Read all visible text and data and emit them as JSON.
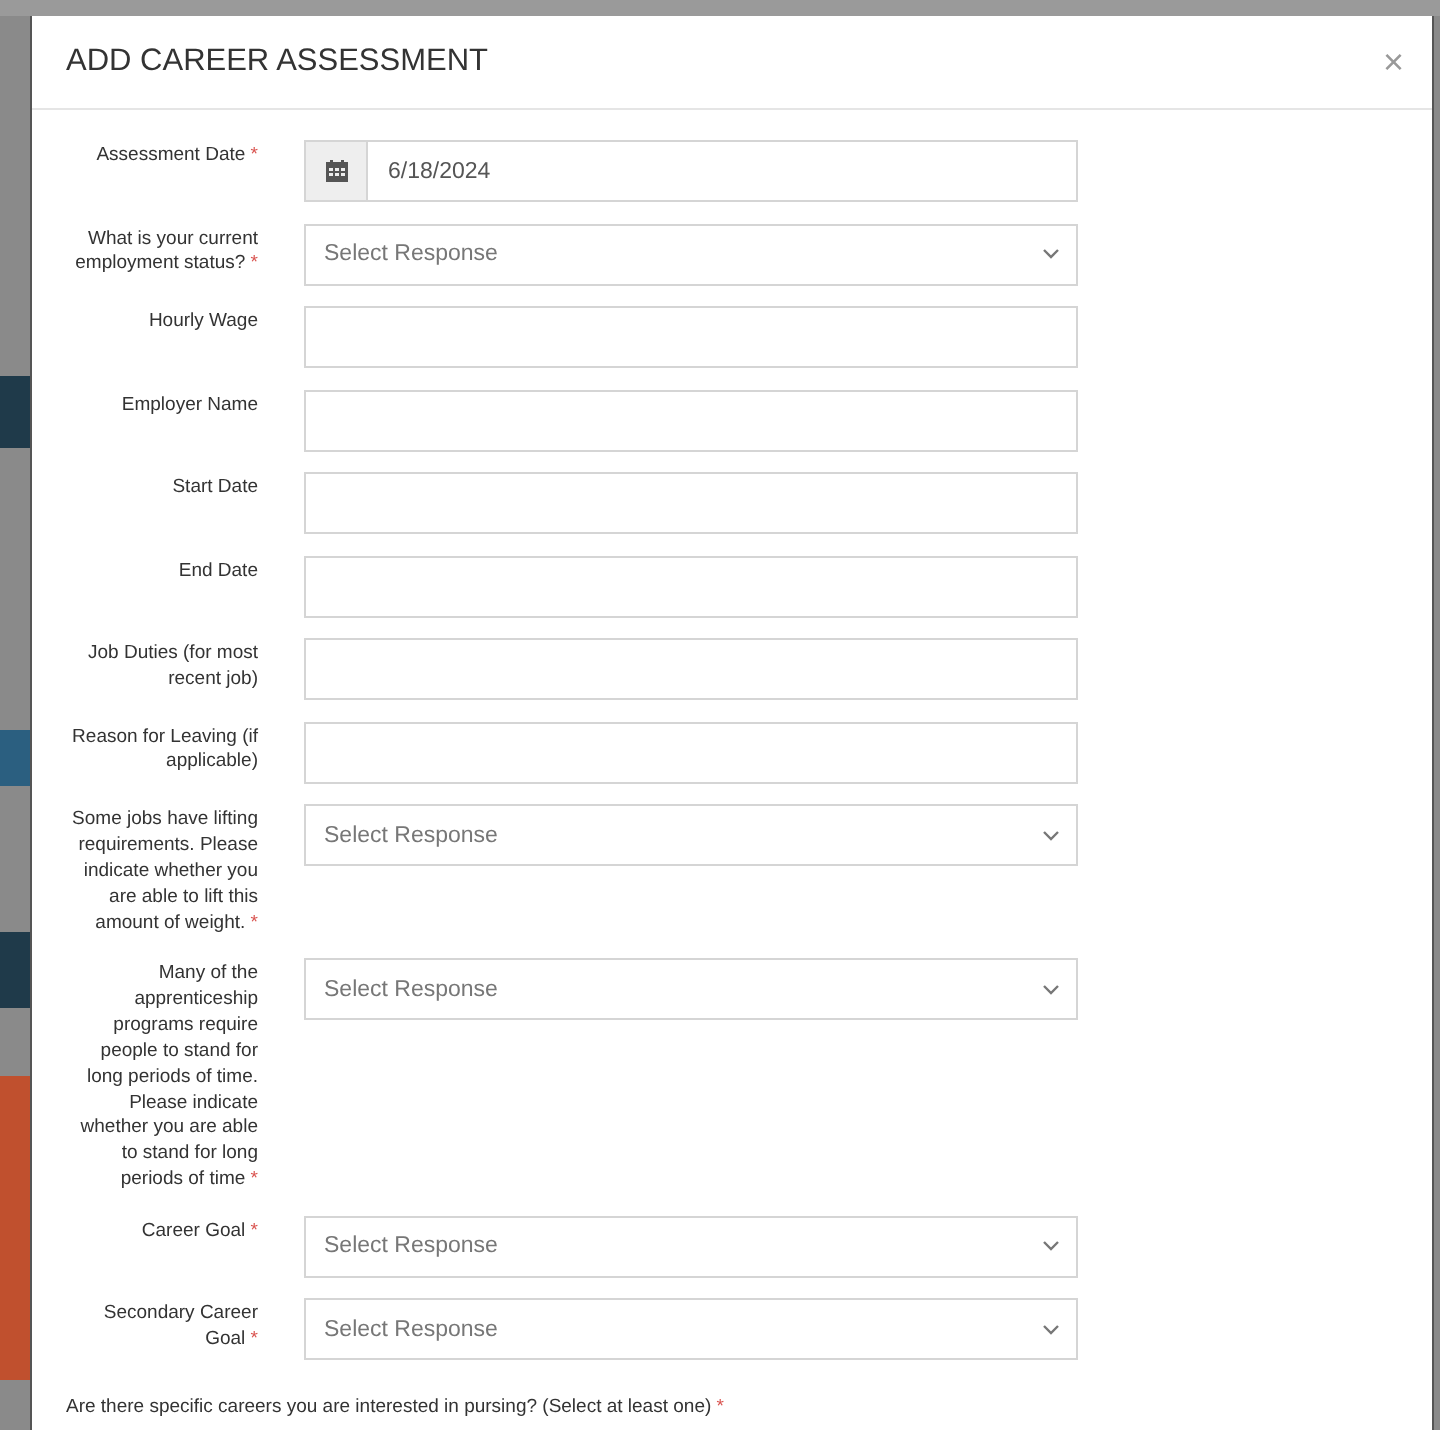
{
  "dialog": {
    "title": "ADD CAREER ASSESSMENT",
    "close": "×"
  },
  "fields": [
    {
      "kind": "date",
      "label": "Assessment Date",
      "required_mark": "*",
      "value": "6/18/2024"
    },
    {
      "kind": "select",
      "label": "What is your current employment status?",
      "required_mark": "*",
      "placeholder": "Select Response"
    },
    {
      "kind": "text",
      "label": "Hourly Wage"
    },
    {
      "kind": "text",
      "label": "Employer Name"
    },
    {
      "kind": "text",
      "label": "Start Date"
    },
    {
      "kind": "text",
      "label": "End Date"
    },
    {
      "kind": "text",
      "label": "Job Duties (for most recent job)"
    },
    {
      "kind": "text",
      "label": "Reason for Leaving (if applicable)"
    },
    {
      "kind": "select",
      "label": "Some jobs have lifting requirements. Please indicate whether you are able to lift this amount of weight.",
      "required_mark": "*",
      "placeholder": "Select Response"
    },
    {
      "kind": "select",
      "label": "Many of the apprenticeship programs require people to stand for long periods of time. Please indicate whether you are able to stand for long periods of time",
      "required_mark": "*",
      "placeholder": "Select Response"
    },
    {
      "kind": "select",
      "label": "Career Goal",
      "required_mark": "*",
      "placeholder": "Select Response"
    },
    {
      "kind": "select",
      "label": "Secondary Career Goal",
      "required_mark": "*",
      "placeholder": "Select Response"
    }
  ],
  "question": {
    "label": "Are there specific careers you are interested in pursing? (Select at least one)",
    "required_mark": "*"
  }
}
